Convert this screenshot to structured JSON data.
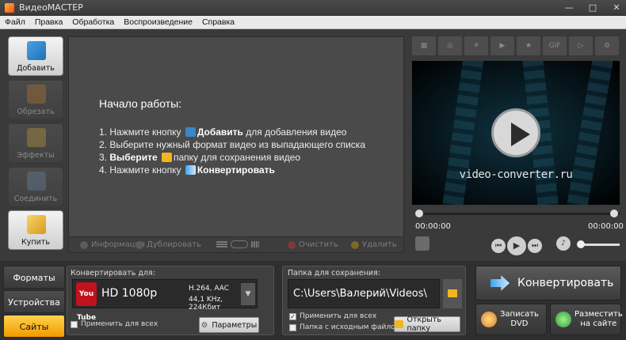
{
  "window": {
    "title": "ВидеоМАСТЕР"
  },
  "menu": [
    "Файл",
    "Правка",
    "Обработка",
    "Воспроизведение",
    "Справка"
  ],
  "sidebar": [
    {
      "label": "Добавить",
      "icon": "add-film-icon",
      "state": "active"
    },
    {
      "label": "Обрезать",
      "icon": "scissors-icon",
      "state": "disabled"
    },
    {
      "label": "Эффекты",
      "icon": "effects-wand-icon",
      "state": "disabled"
    },
    {
      "label": "Соединить",
      "icon": "join-icon",
      "state": "disabled"
    },
    {
      "label": "Купить",
      "icon": "key-tag-icon",
      "state": "active"
    }
  ],
  "start": {
    "heading": "Начало работы:",
    "step1_pre": "1. Нажмите кнопку",
    "step1_bold": "Добавить",
    "step1_post": "для добавления видео",
    "step2": "2. Выберите нужный формат видео из выпадающего списка",
    "step3_pre": "3.",
    "step3_bold": "Выберите",
    "step3_post": "папку для сохранения видео",
    "step4_pre": "4. Нажмите кнопку",
    "step4_bold": "Конвертировать"
  },
  "center_toolbar": {
    "info": "Информация",
    "duplicate": "Дублировать",
    "clear": "Очистить",
    "delete": "Удалить"
  },
  "preview": {
    "site": "video-converter.ru",
    "time_start": "00:00:00",
    "time_end": "00:00:00"
  },
  "tabs": [
    {
      "label": "Форматы",
      "selected": false
    },
    {
      "label": "Устройства",
      "selected": false
    },
    {
      "label": "Сайты",
      "selected": true
    }
  ],
  "convert_for": {
    "label": "Конвертировать для:",
    "logo_text": "You Tube",
    "format": "HD 1080p",
    "codec": "H.264, AAC",
    "audio": "44,1 KHz, 224Кбит",
    "apply_all": "Применить для всех",
    "apply_all_checked": false,
    "params": "Параметры"
  },
  "save_folder": {
    "label": "Папка для сохранения:",
    "path": "C:\\Users\\Валерий\\Videos\\",
    "apply_all": "Применить для всех",
    "apply_all_checked": true,
    "source_folder": "Папка с исходным файлом",
    "source_folder_checked": false,
    "open_folder": "Открыть папку"
  },
  "actions": {
    "convert": "Конвертировать",
    "burn_dvd": "Записать\nDVD",
    "publish": "Разместить\nна сайте"
  },
  "colors": {
    "accent_tab": "#f29a00",
    "youtube": "#c0131d"
  }
}
